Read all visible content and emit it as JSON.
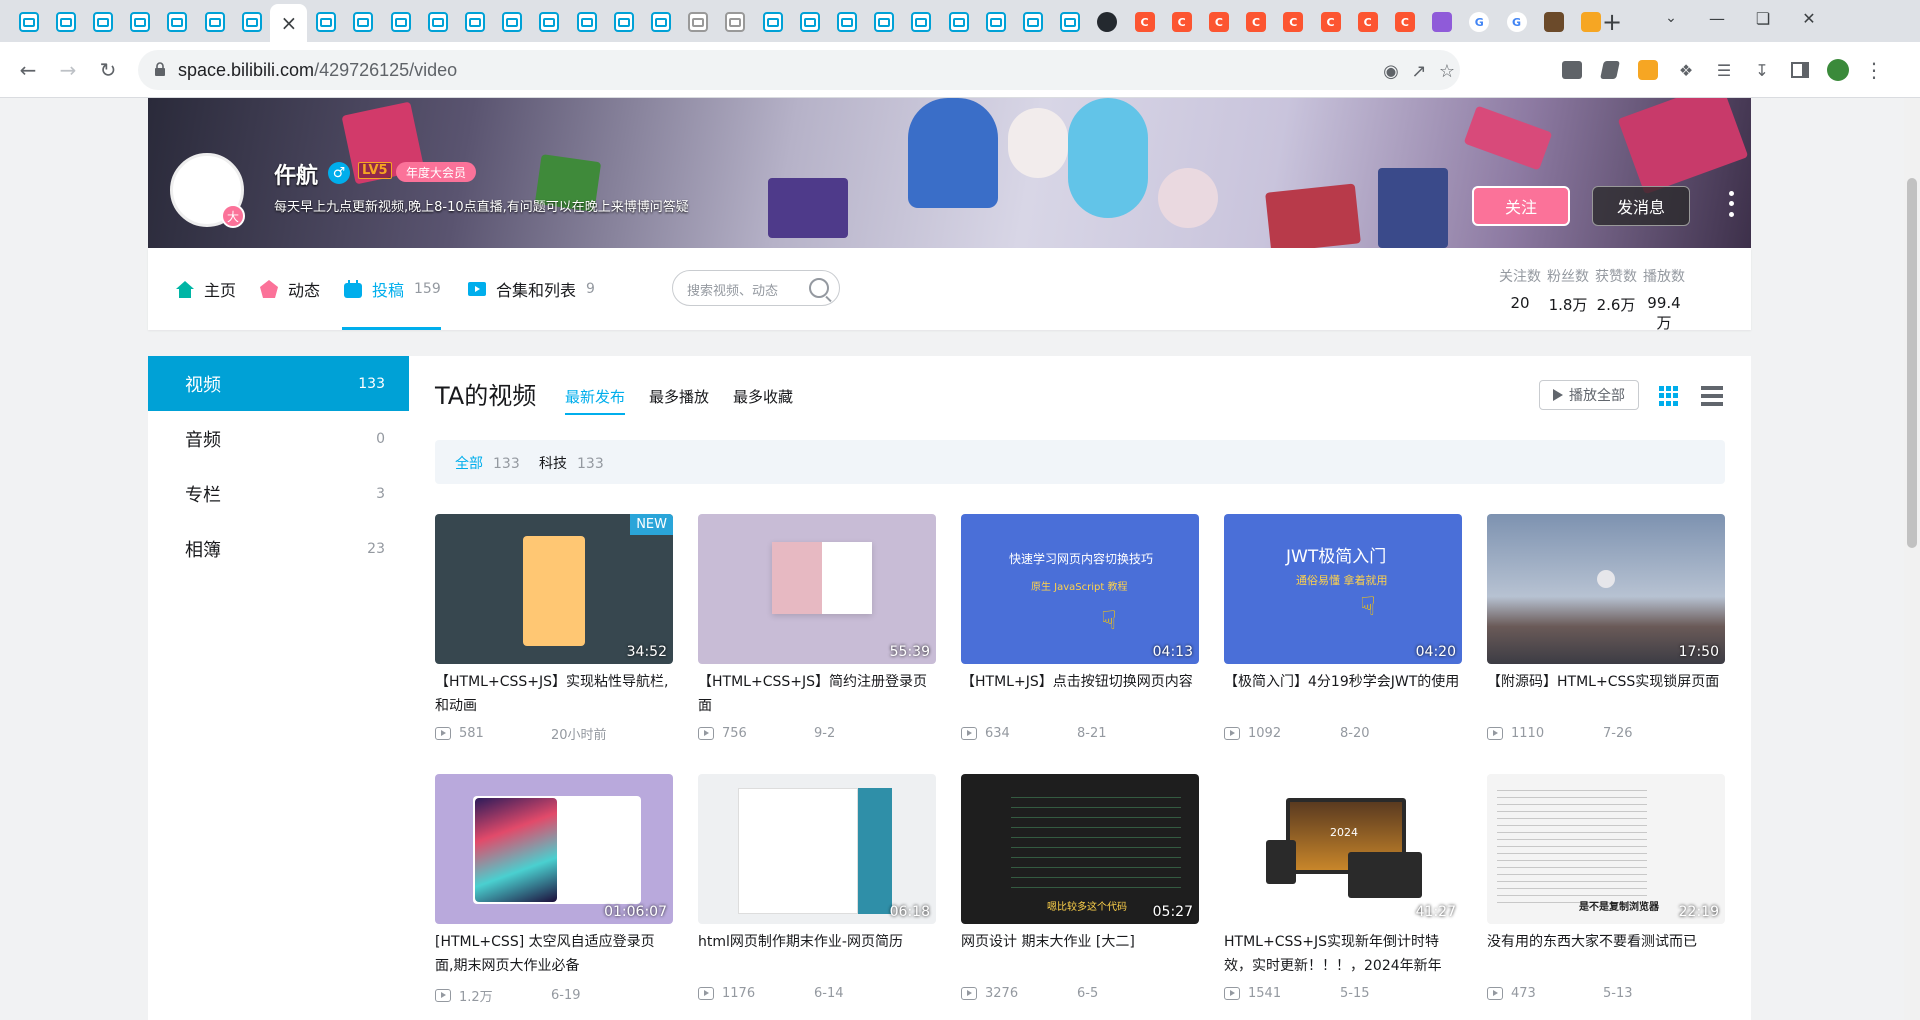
{
  "browser": {
    "tab_count_bili": 20,
    "close_glyph": "×",
    "newtab_glyph": "+",
    "url_host": "space.bilibili.com",
    "url_path": "/429726125/video"
  },
  "profile": {
    "name": "仵航",
    "level": "LV5",
    "vip": "年度大会员",
    "sign": "每天早上九点更新视频,晚上8-10点直播,有问题可以在晚上来博博问答疑",
    "pendant": "大",
    "follow_label": "关注",
    "message_label": "发消息"
  },
  "nav": {
    "home": "主页",
    "dynamic": "动态",
    "upload": "投稿",
    "upload_count": "159",
    "collection": "合集和列表",
    "collection_count": "9",
    "search_placeholder": "搜索视频、动态"
  },
  "stats": [
    {
      "label": "关注数",
      "value": "20"
    },
    {
      "label": "粉丝数",
      "value": "1.8万"
    },
    {
      "label": "获赞数",
      "value": "2.6万"
    },
    {
      "label": "播放数",
      "value": "99.4万"
    }
  ],
  "sidebar": {
    "items": [
      {
        "label": "视频",
        "count": "133"
      },
      {
        "label": "音频",
        "count": "0"
      },
      {
        "label": "专栏",
        "count": "3"
      },
      {
        "label": "相簿",
        "count": "23"
      }
    ]
  },
  "main": {
    "title": "TA的视频",
    "sort_tabs": [
      "最新发布",
      "最多播放",
      "最多收藏"
    ],
    "play_all": "播放全部",
    "filters": [
      {
        "label": "全部",
        "count": "133"
      },
      {
        "label": "科技",
        "count": "133"
      }
    ]
  },
  "videos": [
    {
      "title": "【HTML+CSS+JS】实现粘性导航栏,和动画",
      "duration": "34:52",
      "plays": "581",
      "date": "20小时前",
      "badge": "NEW"
    },
    {
      "title": "【HTML+CSS+JS】简约注册登录页面",
      "duration": "55:39",
      "plays": "756",
      "date": "9-2"
    },
    {
      "title": "【HTML+JS】点击按钮切换网页内容",
      "duration": "04:13",
      "plays": "634",
      "date": "8-21"
    },
    {
      "title": "【极简入门】4分19秒学会JWT的使用",
      "duration": "04:20",
      "plays": "1092",
      "date": "8-20"
    },
    {
      "title": "【附源码】HTML+CSS实现锁屏页面",
      "duration": "17:50",
      "plays": "1110",
      "date": "7-26"
    },
    {
      "title": "[HTML+CSS] 太空风自适应登录页面,期末网页大作业必备",
      "duration": "01:06:07",
      "plays": "1.2万",
      "date": "6-19"
    },
    {
      "title": "html网页制作期末作业-网页简历",
      "duration": "06:18",
      "plays": "1176",
      "date": "6-14"
    },
    {
      "title": "网页设计 期末大作业 [大二]",
      "duration": "05:27",
      "plays": "3276",
      "date": "6-5"
    },
    {
      "title": "HTML+CSS+JS实现新年倒计时特效，实时更新！！！，2024年新年",
      "duration": "41:27",
      "plays": "1541",
      "date": "5-15"
    },
    {
      "title": "没有用的东西大家不要看测试而已",
      "duration": "22:19",
      "plays": "473",
      "date": "5-13"
    }
  ],
  "thumb_texts": {
    "t3_line1": "快速学习网页内容切换技巧",
    "t3_line2": "原生 JavaScript 教程",
    "t4_line1": "JWT极简入门",
    "t4_line2": "通俗易懂 拿着就用",
    "t8_caption": "嗯比较多这个代码",
    "t10_caption": "是不是复制浏览器",
    "t9_year": "2024"
  },
  "colors": {
    "accent": "#00aeec",
    "pink": "#fb7299",
    "sidebar_active": "#00a1d6"
  },
  "icons": [
    "back-icon",
    "forward-icon",
    "reload-icon",
    "lock-icon",
    "eye-off-icon",
    "share-icon",
    "star-icon",
    "extension-icon",
    "download-icon",
    "sidepanel-icon",
    "home-icon",
    "dynamic-icon",
    "upload-icon",
    "collection-icon",
    "search-icon",
    "grid-view-icon",
    "list-view-icon",
    "play-icon"
  ]
}
